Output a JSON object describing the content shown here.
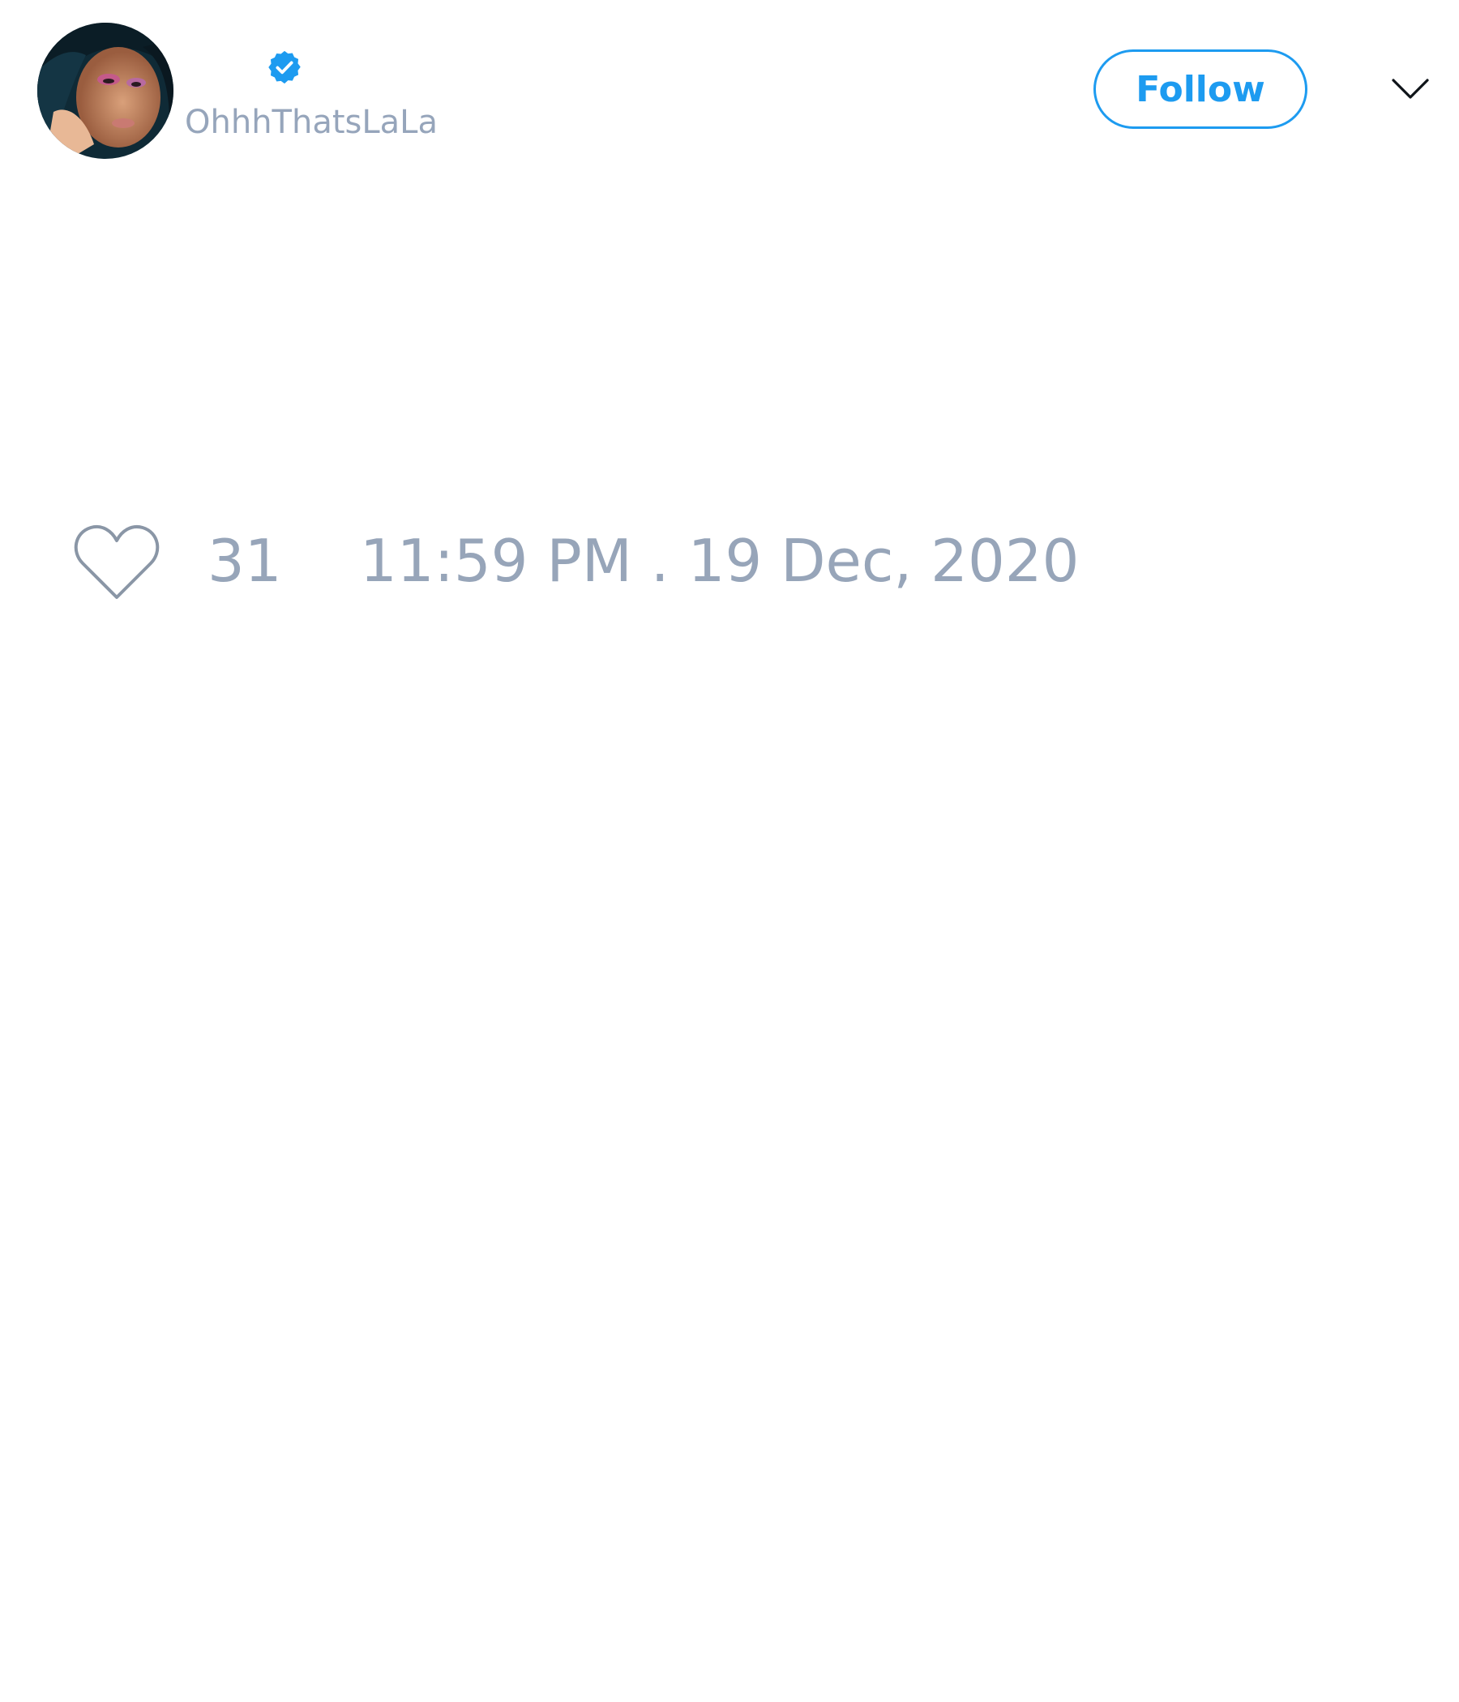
{
  "tweet": {
    "author": {
      "username": "OhhhThatsLaLa",
      "verified": true,
      "avatar": "profile-photo"
    },
    "follow_label": "Follow",
    "menu_icon": "chevron-down-icon",
    "like_icon": "heart-outline-icon",
    "like_count": "31",
    "timestamp": "11:59 PM . 19 Dec, 2020"
  },
  "colors": {
    "accent": "#1d9bf0",
    "muted_text": "#97a5b9",
    "background": "#ffffff"
  }
}
